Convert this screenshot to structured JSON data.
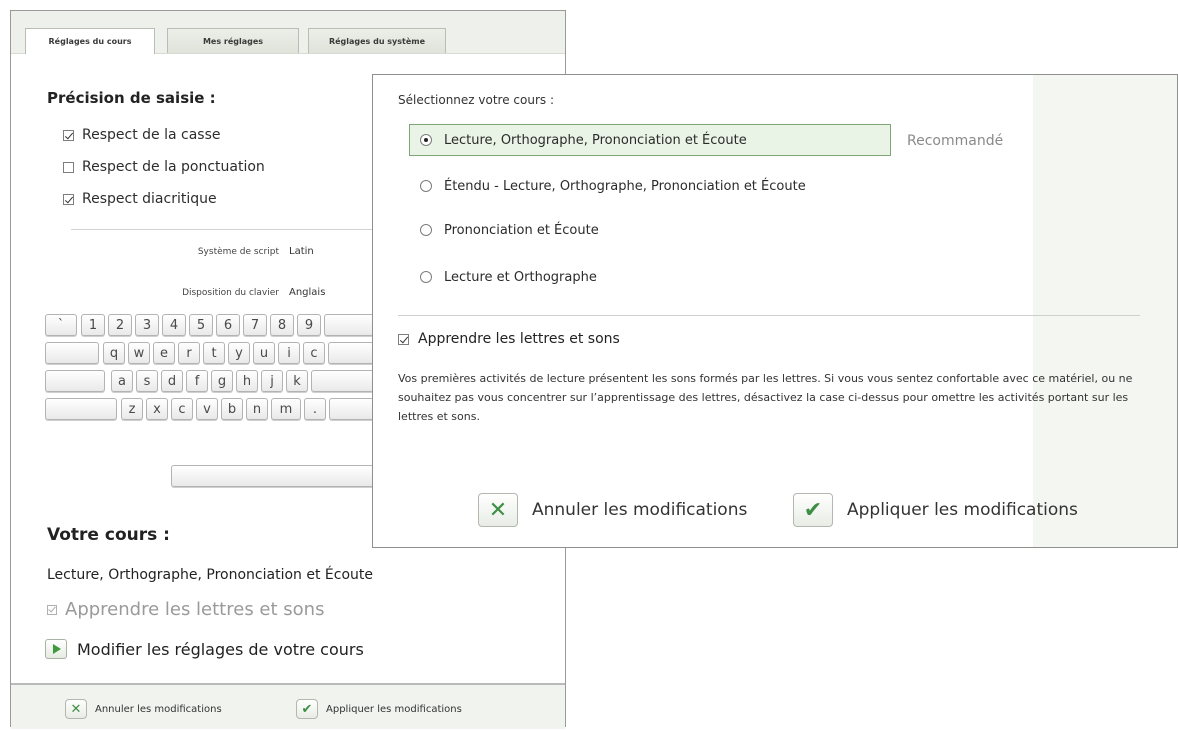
{
  "back_panel": {
    "tabs": [
      {
        "label": "Réglages du cours"
      },
      {
        "label": "Mes réglages"
      },
      {
        "label": "Réglages du système"
      }
    ],
    "precision_title": "Précision de saisie :",
    "options": [
      {
        "label": "Respect de la casse",
        "checked": true
      },
      {
        "label": "Respect de la ponctuation",
        "checked": false
      },
      {
        "label": "Respect diacritique",
        "checked": true
      }
    ],
    "script_label": "Système de script",
    "script_value": "Latin",
    "layout_label": "Disposition du clavier",
    "layout_value": "Anglais",
    "keyboard": {
      "row1": [
        "`",
        "1",
        "2",
        "3",
        "4",
        "5",
        "6",
        "7",
        "8",
        "9"
      ],
      "row2": [
        "q",
        "w",
        "e",
        "r",
        "t",
        "y",
        "u",
        "i",
        "c"
      ],
      "row3": [
        "a",
        "s",
        "d",
        "f",
        "g",
        "h",
        "j",
        "k"
      ],
      "row4": [
        "z",
        "x",
        "c",
        "v",
        "b",
        "n",
        "m",
        "."
      ]
    },
    "votre_cours_title": "Votre cours :",
    "current_course": "Lecture, Orthographe, Prononciation et Écoute",
    "learn_letters": "Apprendre les lettres et sons",
    "modify_label": "Modifier les réglages de votre cours",
    "cancel_label": "Annuler les modifications",
    "apply_label": "Appliquer les modifications"
  },
  "front_dialog": {
    "select_title": "Sélectionnez votre cours :",
    "course_options": [
      {
        "label": "Lecture, Orthographe, Prononciation et Écoute",
        "selected": true
      },
      {
        "label": "Étendu - Lecture, Orthographe, Prononciation et Écoute",
        "selected": false
      },
      {
        "label": "Prononciation et Écoute",
        "selected": false
      },
      {
        "label": "Lecture et Orthographe",
        "selected": false
      }
    ],
    "recommended": "Recommandé",
    "learn_letters": "Apprendre les lettres et sons",
    "learn_letters_checked": true,
    "description": "Vos premières activités de lecture présentent les sons formés par les lettres. Si vous vous sentez confortable avec ce matériel, ou ne souhaitez pas vous concentrer sur l’apprentissage des lettres, désactivez la case ci-dessus pour omettre les activités portant sur les lettres et sons.",
    "cancel_label": "Annuler les modifications",
    "apply_label": "Appliquer les modifications"
  },
  "icons": {
    "checkbox": "check-icon",
    "radio": "radio-icon",
    "play": "play-icon",
    "cancel": "x-icon",
    "apply": "checkmark-icon"
  },
  "colors": {
    "accent_green": "#3c8f45",
    "selected_bg": "#eaf4e6",
    "selected_border": "#7fa579"
  }
}
